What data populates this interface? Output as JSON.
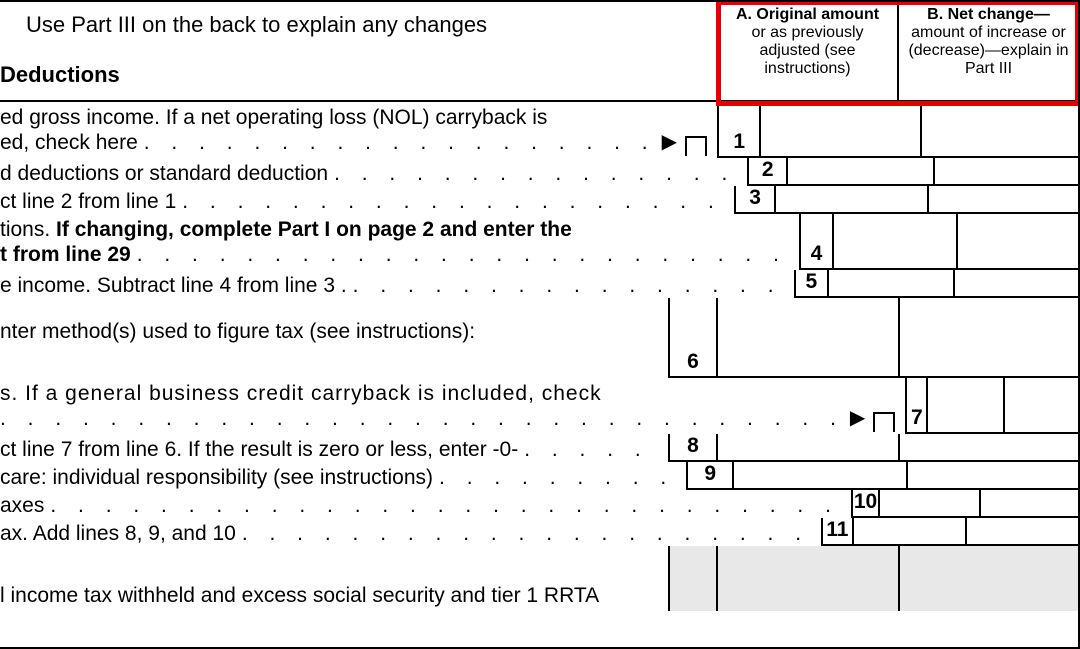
{
  "header": {
    "use_part_iii": "Use Part III on the back to explain any changes",
    "deductions_heading": " Deductions"
  },
  "columns": {
    "a": {
      "bold": "A. Original amount",
      "sub": "or as previously adjusted (see instructions)"
    },
    "b": {
      "bold": "B. Net change—",
      "sub": "amount of increase or (decrease)—explain in Part III"
    }
  },
  "lines": {
    "l1": {
      "n": "1",
      "a": "ed gross income. If a net operating loss (NOL) carryback is",
      "b": "ed, check here"
    },
    "l2": {
      "n": "2",
      "a": "d deductions or standard deduction"
    },
    "l3": {
      "n": "3",
      "a": "ct line 2 from line 1"
    },
    "l4": {
      "n": "4",
      "a": "tions.",
      "bold": "If changing, complete Part I on page 2 and enter the",
      "b": "t from line 29"
    },
    "l5": {
      "n": "5",
      "a": "e income. Subtract line 4 from line 3 ."
    },
    "method": {
      "a": "nter method(s) used to figure tax (see instructions):"
    },
    "l6": {
      "n": "6"
    },
    "l7": {
      "n": "7",
      "a": "s. If a general business credit carryback is included, check"
    },
    "l8": {
      "n": "8",
      "a": "ct line 7 from line 6. If the result is zero or less, enter -0-"
    },
    "l9": {
      "n": "9",
      "a": "care: individual responsibility (see instructions)"
    },
    "l10": {
      "n": "10",
      "a": "axes"
    },
    "l11": {
      "n": "11",
      "a": "ax. Add lines 8, 9, and 10"
    },
    "last": {
      "a": "l income tax withheld and excess social security and tier 1 RRTA"
    }
  }
}
